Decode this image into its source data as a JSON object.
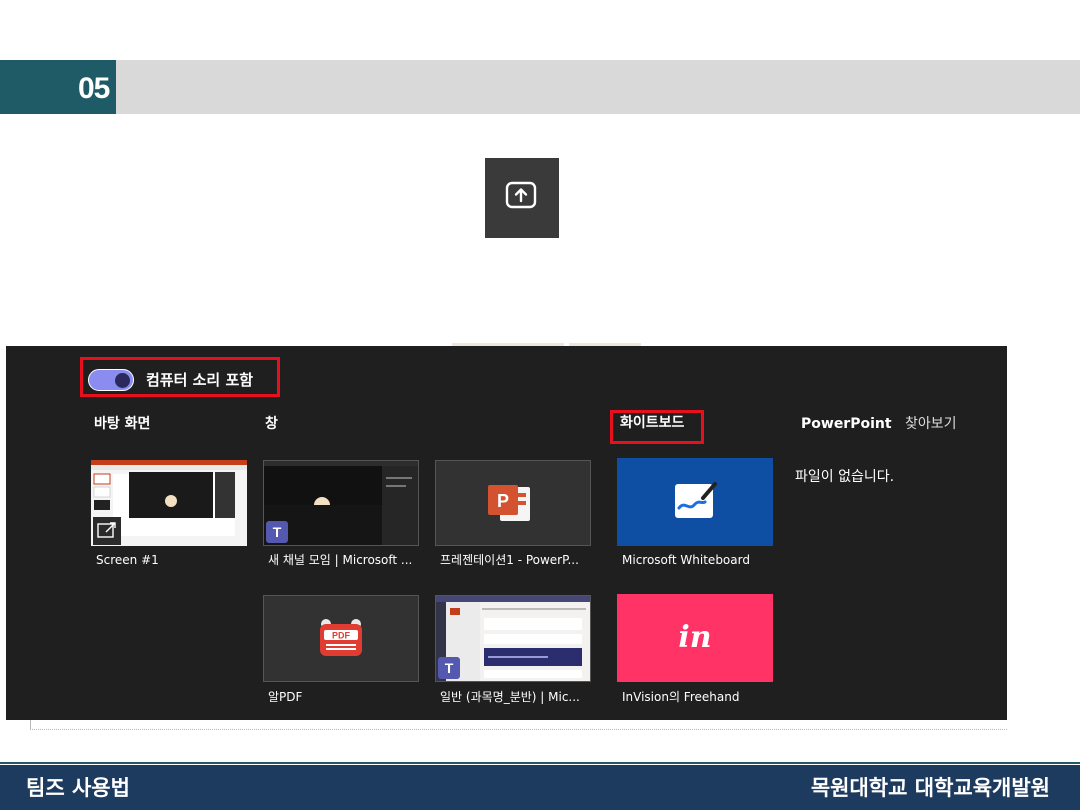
{
  "slide": {
    "number": "05"
  },
  "share_panel": {
    "include_sound_label": "컴퓨터 소리 포함",
    "include_sound_on": true,
    "sections": {
      "desktop": "바탕 화면",
      "window": "창",
      "whiteboard": "화이트보드",
      "powerpoint": "PowerPoint",
      "browse": "찾아보기"
    },
    "desktop_items": [
      {
        "caption": "Screen #1"
      }
    ],
    "window_items": [
      {
        "caption": "새 채널 모임 | Microsoft ..."
      },
      {
        "caption": "프레젠테이션1 - PowerP..."
      },
      {
        "caption": "알PDF"
      },
      {
        "caption": "일반 (과목명_분반) | Mic..."
      }
    ],
    "whiteboard_items": [
      {
        "caption": "Microsoft Whiteboard"
      },
      {
        "caption": "InVision의 Freehand",
        "logo_text": "in"
      }
    ],
    "powerpoint_empty": "파일이 없습니다."
  },
  "footer": {
    "left": "팀즈 사용법",
    "right": "목원대학교 대학교육개발원"
  },
  "colors": {
    "accent_teal": "#1e5b66",
    "highlight_red": "#e8101c",
    "panel_bg": "#1f1f1f",
    "toggle_on": "#8b8cf0",
    "whiteboard_blue": "#0e4ea3",
    "invision_pink": "#ff3366",
    "footer_bg": "#1c3b5e"
  }
}
